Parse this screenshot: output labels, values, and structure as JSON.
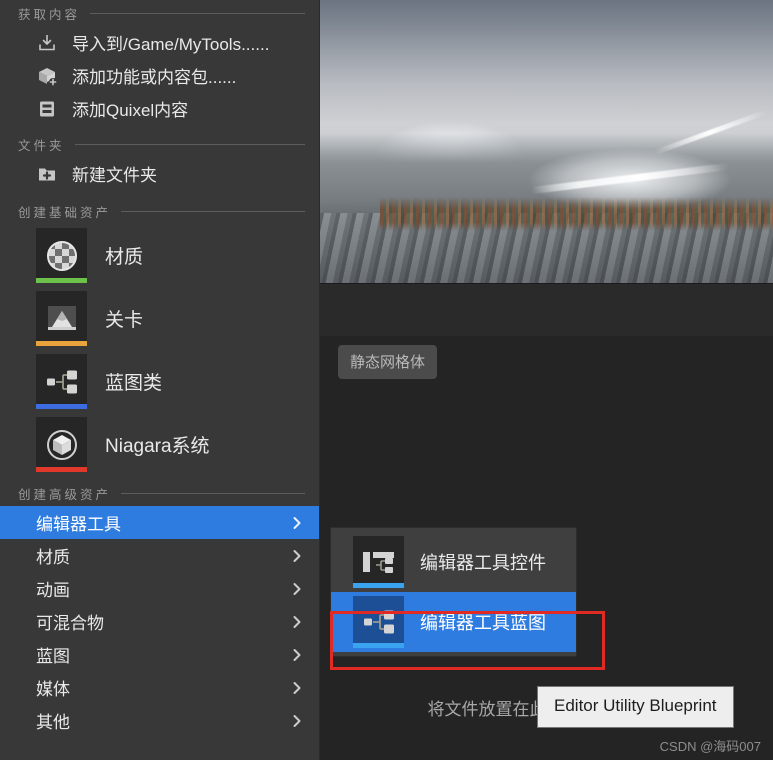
{
  "menu": {
    "sections": [
      {
        "title": "获取内容",
        "items": [
          {
            "label": "导入到/Game/MyTools......",
            "icon": "import-icon"
          },
          {
            "label": "添加功能或内容包......",
            "icon": "add-feature-pack-icon"
          },
          {
            "label": "添加Quixel内容",
            "icon": "quixel-content-icon"
          }
        ]
      },
      {
        "title": "文件夹",
        "items": [
          {
            "label": "新建文件夹",
            "icon": "new-folder-icon"
          }
        ]
      }
    ],
    "basic_assets": {
      "title": "创建基础资产",
      "items": [
        {
          "label": "材质",
          "icon": "material-sphere-icon",
          "bar_color": "#6cc24a"
        },
        {
          "label": "关卡",
          "icon": "level-icon",
          "bar_color": "#e8a33d"
        },
        {
          "label": "蓝图类",
          "icon": "blueprint-class-icon",
          "bar_color": "#3d6ce0"
        },
        {
          "label": "Niagara系统",
          "icon": "niagara-system-icon",
          "bar_color": "#e0392b"
        }
      ]
    },
    "advanced_assets": {
      "title": "创建高级资产",
      "items": [
        {
          "label": "编辑器工具",
          "selected": true
        },
        {
          "label": "材质",
          "selected": false
        },
        {
          "label": "动画",
          "selected": false
        },
        {
          "label": "可混合物",
          "selected": false
        },
        {
          "label": "蓝图",
          "selected": false
        },
        {
          "label": "媒体",
          "selected": false
        },
        {
          "label": "其他",
          "selected": false
        }
      ]
    }
  },
  "submenu": {
    "items": [
      {
        "label": "编辑器工具控件",
        "icon": "editor-utility-widget-icon",
        "selected": false
      },
      {
        "label": "编辑器工具蓝图",
        "icon": "editor-utility-blueprint-icon",
        "selected": true
      }
    ]
  },
  "tooltip": {
    "text": "Editor Utility Blueprint"
  },
  "editor": {
    "static_mesh_chip": "静态网格体",
    "drop_hint": "将文件放置在此处以导入内容。"
  },
  "watermark": {
    "text": "CSDN @海码007"
  },
  "colors": {
    "accent_blue": "#2f7ce0",
    "highlight_red": "#e02b24",
    "menu_bg": "#383838",
    "submenu_bg": "#3f3f3f"
  }
}
